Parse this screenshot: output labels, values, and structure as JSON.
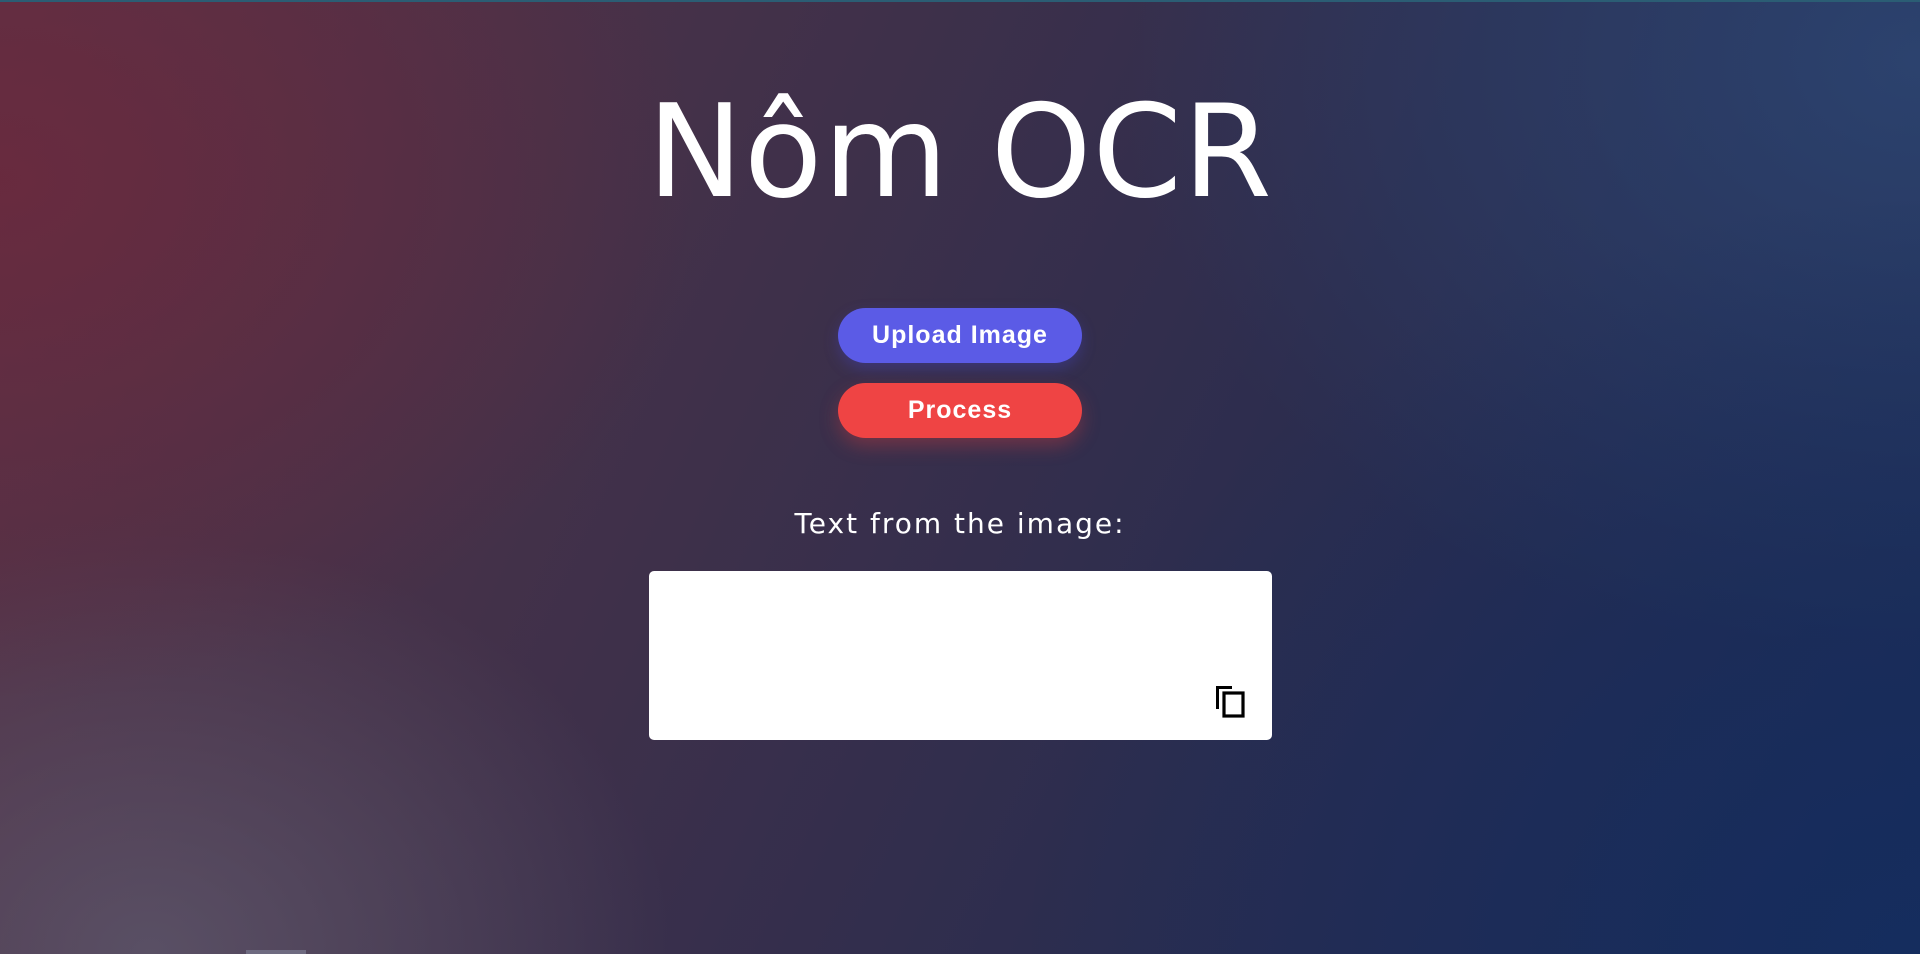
{
  "page": {
    "title": "Nôm OCR"
  },
  "actions": {
    "upload_label": "Upload Image",
    "process_label": "Process"
  },
  "result": {
    "label": "Text from the image:",
    "text": "",
    "copy_icon": "copy-icon"
  },
  "colors": {
    "upload_button": "#5b5be6",
    "process_button": "#ef4444",
    "text": "#ffffff",
    "output_background": "#ffffff"
  }
}
